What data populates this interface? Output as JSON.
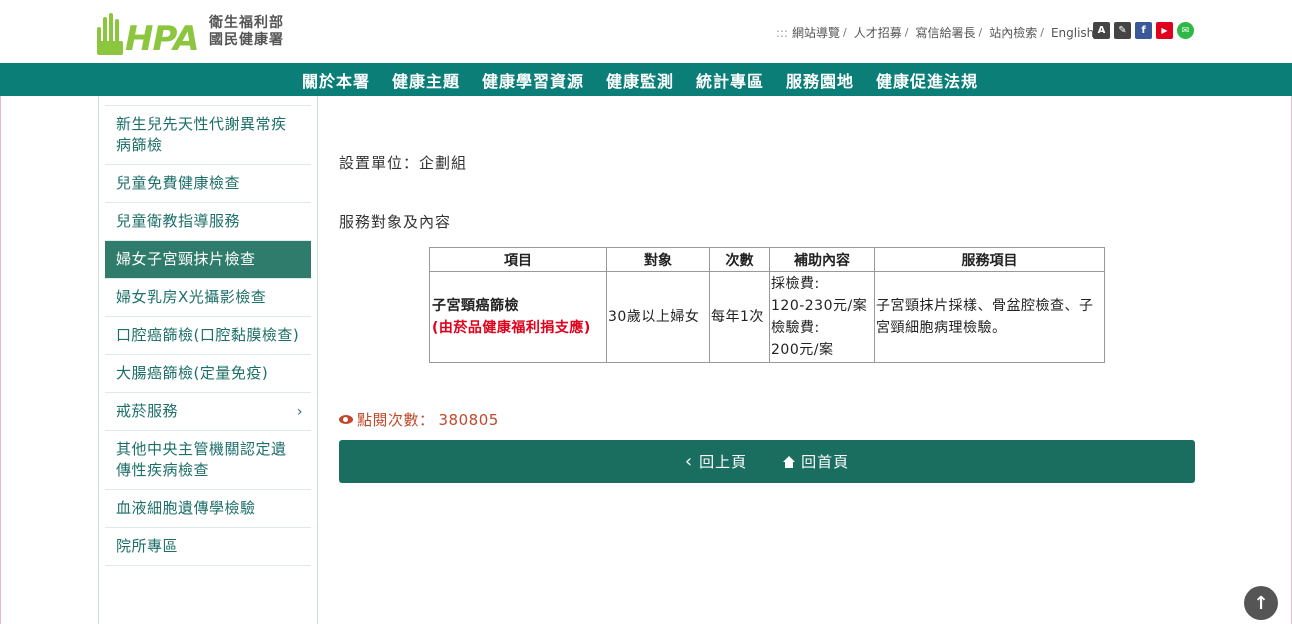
{
  "header": {
    "logo_letters": "HPA",
    "org_line1": "衛生福利部",
    "org_line2": "國民健康署",
    "toplinks_prefix": ":::",
    "toplinks": [
      "網站導覽",
      "人才招募",
      "寫信給署長",
      "站內檢索",
      "English"
    ],
    "social": [
      {
        "icon": "font-size-icon",
        "glyph": "A",
        "color": "#444444"
      },
      {
        "icon": "brush-icon",
        "glyph": "✎",
        "color": "#444444"
      },
      {
        "icon": "facebook-icon",
        "glyph": "f",
        "color": "#3b5998"
      },
      {
        "icon": "youtube-icon",
        "glyph": "▶",
        "color": "#e0001b"
      },
      {
        "icon": "line-icon",
        "glyph": "✉",
        "color": "#2fb845"
      }
    ]
  },
  "nav": {
    "items": [
      "關於本署",
      "健康主題",
      "健康學習資源",
      "健康監測",
      "統計專區",
      "服務園地",
      "健康促進法規"
    ]
  },
  "sidebar": {
    "items": [
      {
        "label": "新生兒先天性代謝異常疾病篩檢",
        "active": false
      },
      {
        "label": "兒童免費健康檢查",
        "active": false
      },
      {
        "label": "兒童衛教指導服務",
        "active": false
      },
      {
        "label": "婦女子宮頸抹片檢查",
        "active": true
      },
      {
        "label": "婦女乳房X光攝影檢查",
        "active": false
      },
      {
        "label": "口腔癌篩檢(口腔黏膜檢查)",
        "active": false
      },
      {
        "label": "大腸癌篩檢(定量免疫)",
        "active": false
      },
      {
        "label": "戒菸服務",
        "active": false,
        "chevron": "›"
      },
      {
        "label": "其他中央主管機關認定遺傳性疾病檢查",
        "active": false
      },
      {
        "label": "血液細胞遺傳學檢驗",
        "active": false
      },
      {
        "label": "院所專區",
        "active": false
      }
    ]
  },
  "main": {
    "unit": "設置單位：企劃組",
    "service_heading": "服務對象及內容",
    "table": {
      "headers": [
        "項目",
        "對象",
        "次數",
        "補助內容",
        "服務項目"
      ],
      "row": {
        "item_name": "子宮頸癌篩檢",
        "item_note": "(由菸品健康福利捐支應)",
        "target": "30歲以上婦女",
        "frequency": "每年1次",
        "subsidy_lines": [
          "採檢費:",
          "120-230元/案",
          "檢驗費:",
          "200元/案"
        ],
        "services": "子宮頸抹片採樣、骨盆腔檢查、子宮頸細胞病理檢驗。"
      }
    },
    "views_label": "點閱次數：",
    "views_count": "380805",
    "back_label": "回上頁",
    "home_label": "回首頁"
  },
  "colors": {
    "brand_green": "#8cc63f",
    "nav_teal": "#0b7e78",
    "active_item": "#2f7c6c",
    "button_bar": "#1a6e60",
    "views_text": "#c0492a",
    "note_red": "#e0001b"
  }
}
